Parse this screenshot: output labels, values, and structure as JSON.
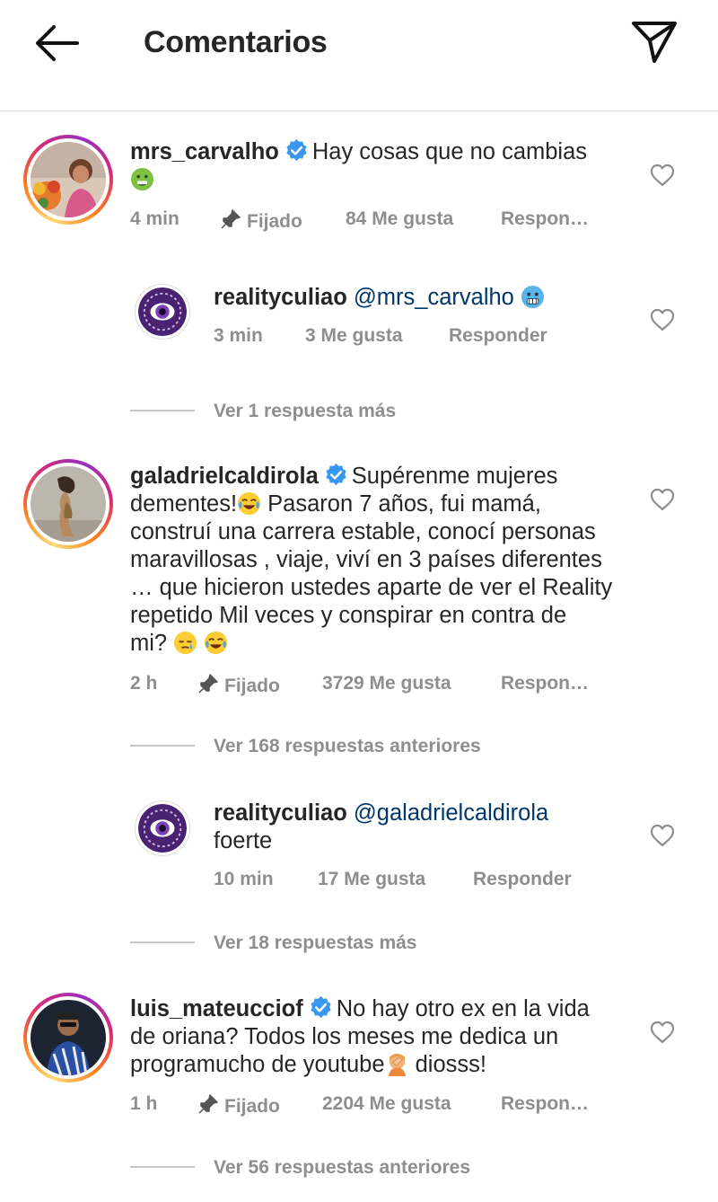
{
  "header": {
    "title": "Comentarios",
    "back_icon": "arrow-left-icon",
    "share_icon": "paper-plane-icon"
  },
  "comments": [
    {
      "username": "mrs_carvalho",
      "verified": true,
      "text": "Hay cosas que no cambias",
      "emoji": [
        "nauseated-face"
      ],
      "time": "4 min",
      "pinned_label": "Fijado",
      "likes": "84 Me gusta",
      "reply_label": "Respon…"
    },
    {
      "username": "realityculiao",
      "mention": "@mrs_carvalho",
      "emoji": [
        "cold-face"
      ],
      "time": "3 min",
      "likes": "3 Me gusta",
      "reply_label": "Responder"
    },
    {
      "username": "galadrielcaldirola",
      "verified": true,
      "text_lines": [
        "Supérenme mujeres",
        "dementes!",
        "Pasaron 7 años, fui mamá,",
        "construí una carrera estable, conocí personas",
        "maravillosas , viaje, viví en 3 países diferentes",
        "… que hicieron ustedes aparte de ver el Reality",
        "repetido Mil veces y conspirar en contra de",
        "mi?"
      ],
      "emoji": [
        "face-with-tears-of-joy",
        "sleepy-face",
        "face-with-tears-of-joy"
      ],
      "time": "2 h",
      "pinned_label": "Fijado",
      "likes": "3729 Me gusta",
      "reply_label": "Respon…"
    },
    {
      "username": "realityculiao",
      "mention": "@galadrielcaldirola",
      "text": "foerte",
      "time": "10 min",
      "likes": "17 Me gusta",
      "reply_label": "Responder"
    },
    {
      "username": "luis_mateucciof",
      "verified": true,
      "text_lines": [
        "No hay otro ex en la vida",
        "de oriana? Todos los meses me dedica un",
        "programucho de youtube",
        "diosss!"
      ],
      "emoji": [
        "person-facepalming"
      ],
      "time": "1 h",
      "pinned_label": "Fijado",
      "likes": "2204 Me gusta",
      "reply_label": "Respon…"
    }
  ],
  "reply_toggles": [
    "Ver 1 respuesta más",
    "Ver 168 respuestas anteriores",
    "Ver 18 respuestas más",
    "Ver 56 respuestas anteriores"
  ],
  "colors": {
    "text": "#262626",
    "muted": "#8e8e8e",
    "mention": "#00376b",
    "verified": "#3897f0",
    "divider": "#dbdbdb",
    "reality_purple": "#5b2a86"
  }
}
